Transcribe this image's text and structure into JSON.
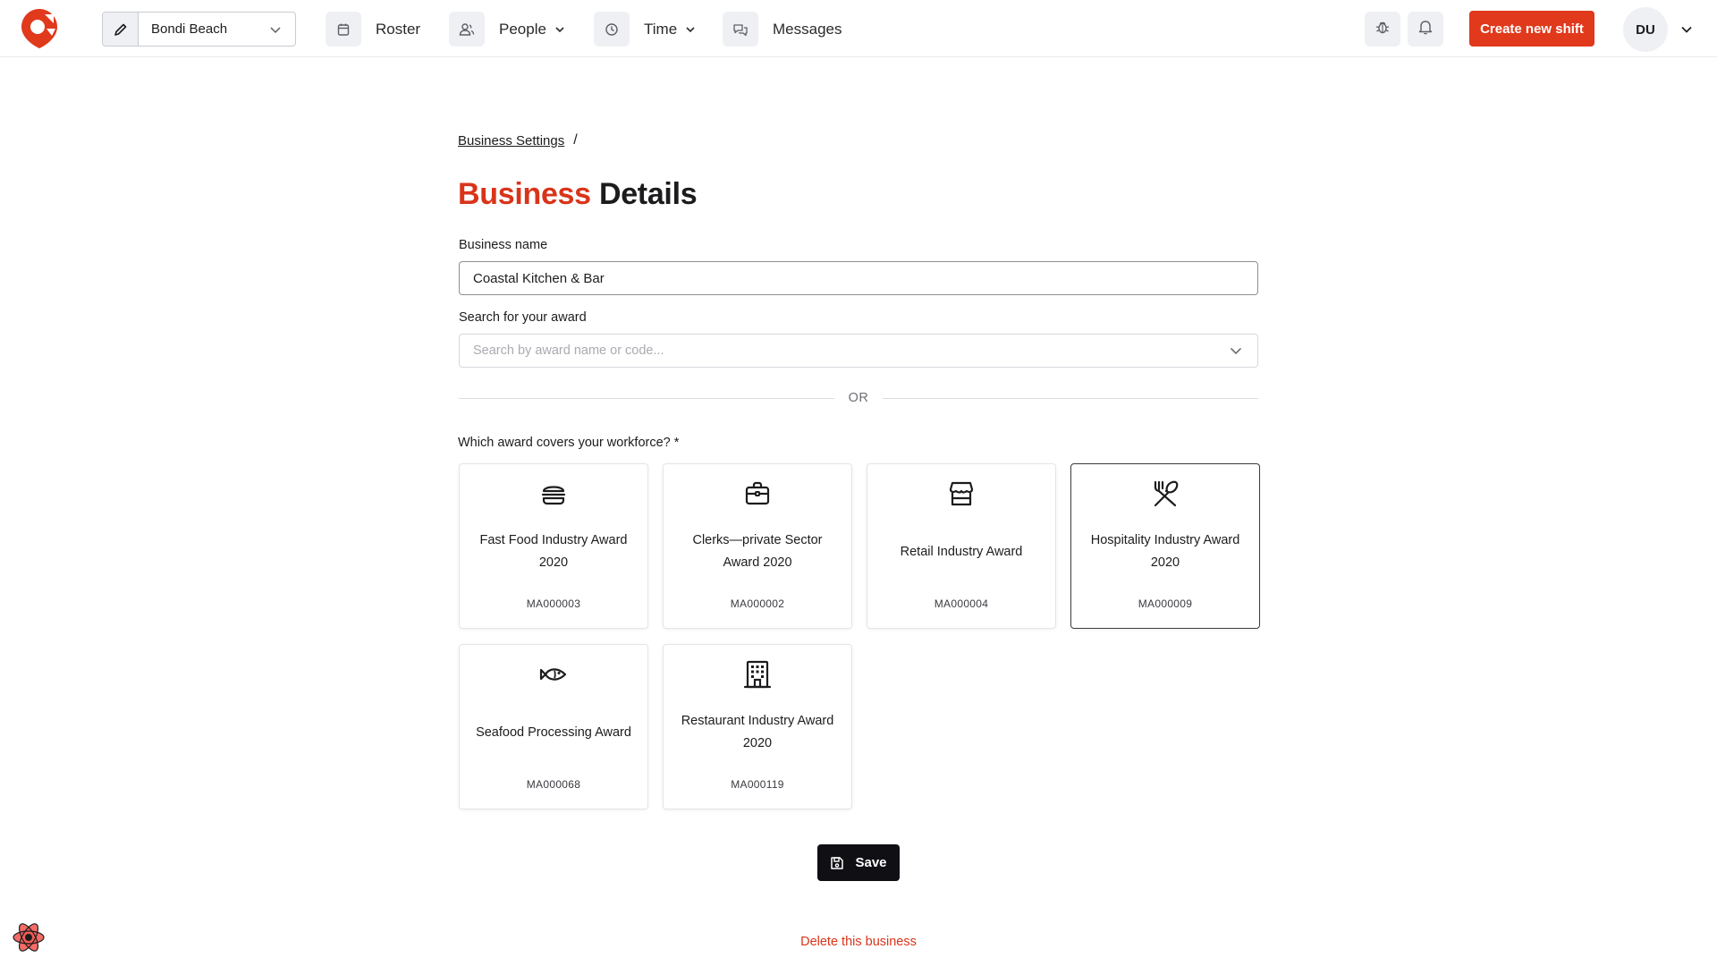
{
  "header": {
    "location": "Bondi Beach",
    "nav": {
      "roster": "Roster",
      "people": "People",
      "time": "Time",
      "messages": "Messages"
    },
    "create_shift": "Create new shift",
    "user_initials": "DU"
  },
  "breadcrumb": {
    "parent": "Business Settings",
    "separator": "/"
  },
  "title": {
    "accent": "Business",
    "rest": "Details"
  },
  "form": {
    "business_name_label": "Business name",
    "business_name_value": "Coastal Kitchen & Bar",
    "award_search_label": "Search for your award",
    "award_search_placeholder": "Search by award name or code...",
    "or_text": "OR",
    "award_question": "Which award covers your workforce? *"
  },
  "awards": [
    {
      "title": "Fast Food Industry Award 2020",
      "code": "MA000003",
      "icon": "burger-icon",
      "selected": false
    },
    {
      "title": "Clerks—private Sector Award 2020",
      "code": "MA000002",
      "icon": "briefcase-icon",
      "selected": false
    },
    {
      "title": "Retail Industry Award",
      "code": "MA000004",
      "icon": "store-icon",
      "selected": false
    },
    {
      "title": "Hospitality Industry Award 2020",
      "code": "MA000009",
      "icon": "utensils-crossed-icon",
      "selected": true
    },
    {
      "title": "Seafood Processing Award",
      "code": "MA000068",
      "icon": "fish-icon",
      "selected": false
    },
    {
      "title": "Restaurant Industry Award 2020",
      "code": "MA000119",
      "icon": "building-icon",
      "selected": false
    }
  ],
  "actions": {
    "save": "Save",
    "delete": "Delete this business"
  },
  "colors": {
    "brand": "#e0391c",
    "accent_text": "#d9341a",
    "dark_button": "#0f0f14"
  }
}
